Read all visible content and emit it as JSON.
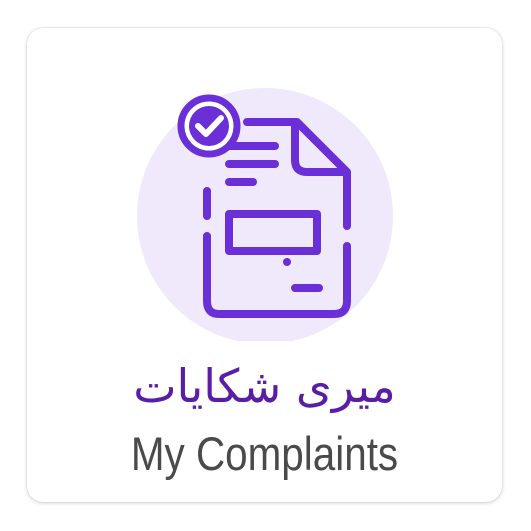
{
  "tile": {
    "icon": "complaint-document-check-icon",
    "title_urdu": "میری شکایات",
    "title_english": "My Complaints"
  },
  "colors": {
    "accent": "#6a2fd6",
    "icon_circle": "#efe9fb",
    "urdu_text": "#5a1ea6",
    "english_text": "#4a4a4a",
    "background": "#ffffff"
  }
}
